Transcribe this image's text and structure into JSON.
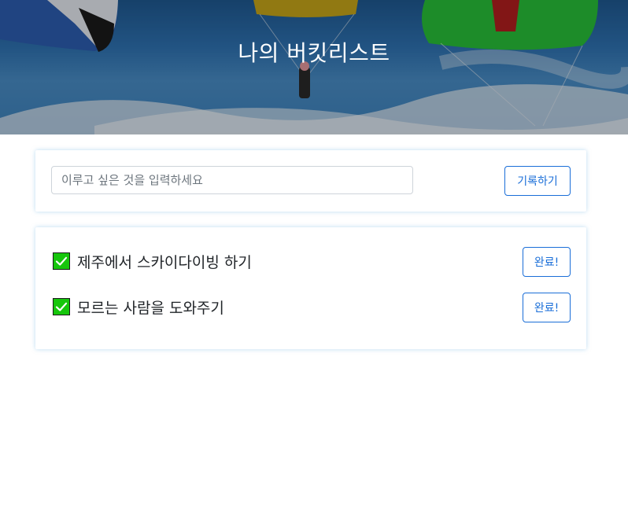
{
  "header": {
    "title": "나의 버킷리스트"
  },
  "form": {
    "placeholder": "이루고 싶은 것을 입력하세요",
    "value": "",
    "record_label": "기록하기"
  },
  "list": {
    "items": [
      {
        "text": "제주에서 스카이다이빙 하기",
        "done": true,
        "button_label": "완료!"
      },
      {
        "text": "모르는 사람을 도와주기",
        "done": true,
        "button_label": "완료!"
      }
    ]
  },
  "colors": {
    "accent": "#1a6ed8",
    "check": "#16c60c",
    "card_glow": "#82bee6"
  },
  "icons": {
    "check": "check-icon"
  }
}
